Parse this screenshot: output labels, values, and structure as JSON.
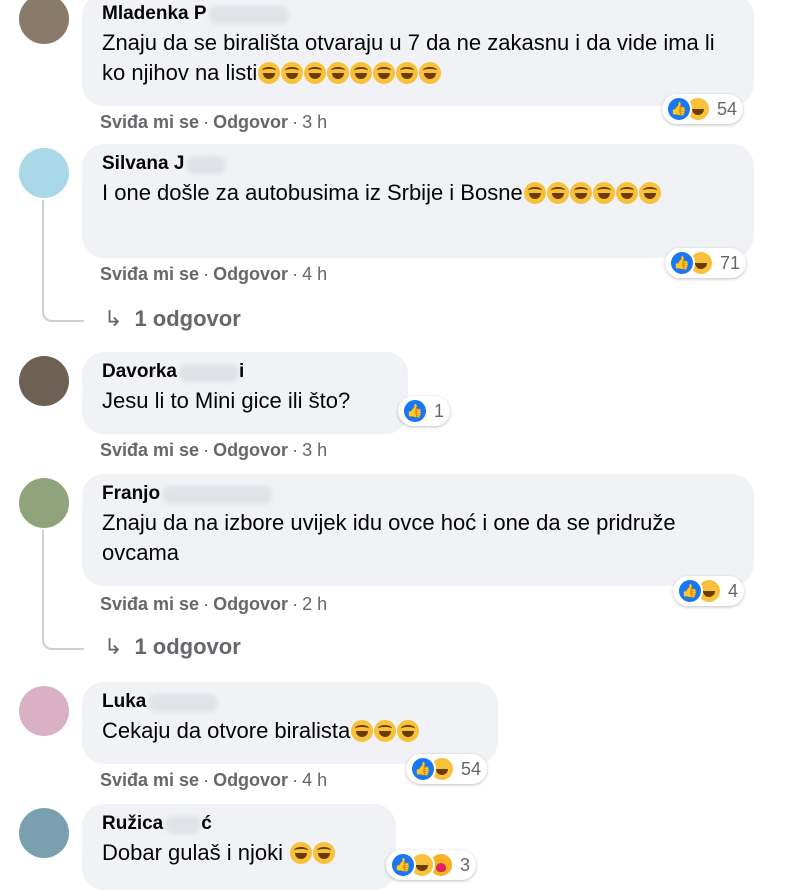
{
  "comments": [
    {
      "author": "Mladenka P",
      "text": "Znaju da se birališta otvaraju u 7 da ne zakasnu i da vide ima li ko njihov na listi",
      "emoji_count": 8,
      "reaction_count": "54",
      "reactions": [
        "like-icon",
        "haha-icon"
      ],
      "actions": {
        "like": "Sviđa mi se",
        "reply": "Odgovor",
        "time": "3 h"
      }
    },
    {
      "author": "Silvana J",
      "text": "I one došle za autobusima iz Srbije i Bosne",
      "emoji_count": 6,
      "reaction_count": "71",
      "reactions": [
        "like-icon",
        "haha-icon"
      ],
      "actions": {
        "like": "Sviđa mi se",
        "reply": "Odgovor",
        "time": "4 h"
      },
      "replies_label": "1 odgovor"
    },
    {
      "author": "Davorka",
      "author_suffix": "i",
      "text": "Jesu li to Mini gice ili što?",
      "emoji_count": 0,
      "reaction_count": "1",
      "reactions": [
        "like-icon"
      ],
      "actions": {
        "like": "Sviđa mi se",
        "reply": "Odgovor",
        "time": "3 h"
      }
    },
    {
      "author": "Franjo",
      "text": "Znaju da na izbore uvijek idu ovce hoć i one da se pridruže ovcama",
      "emoji_count": 0,
      "reaction_count": "4",
      "reactions": [
        "like-icon",
        "haha-icon"
      ],
      "actions": {
        "like": "Sviđa mi se",
        "reply": "Odgovor",
        "time": "2 h"
      },
      "replies_label": "1 odgovor"
    },
    {
      "author": "Luka",
      "text": "Cekaju da otvore biralista",
      "emoji_count": 3,
      "reaction_count": "54",
      "reactions": [
        "like-icon",
        "haha-icon"
      ],
      "actions": {
        "like": "Sviđa mi se",
        "reply": "Odgovor",
        "time": "4 h"
      }
    },
    {
      "author": "Ružica",
      "author_suffix": "ć",
      "text": "Dobar gulaš i njoki",
      "emoji_count": 2,
      "reaction_count": "3",
      "reactions": [
        "like-icon",
        "haha-icon",
        "care-icon"
      ]
    }
  ],
  "colors": {
    "bubble": "#f0f2f5",
    "like": "#1877f2",
    "meta": "#65676b"
  }
}
